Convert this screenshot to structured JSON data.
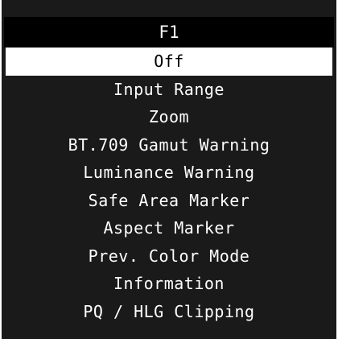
{
  "osd": {
    "title": "F1",
    "selected_index": 0,
    "items": [
      {
        "label": "Off"
      },
      {
        "label": "Input Range"
      },
      {
        "label": "Zoom"
      },
      {
        "label": "BT.709 Gamut Warning"
      },
      {
        "label": "Luminance Warning"
      },
      {
        "label": "Safe Area Marker"
      },
      {
        "label": "Aspect Marker"
      },
      {
        "label": "Prev. Color Mode"
      },
      {
        "label": "Information"
      },
      {
        "label": "PQ / HLG Clipping"
      }
    ]
  },
  "colors": {
    "panel_background": "#1a1a1a",
    "title_background": "#000000",
    "selected_background": "#ffffff",
    "selected_text": "#000000",
    "text": "#ffffff"
  }
}
